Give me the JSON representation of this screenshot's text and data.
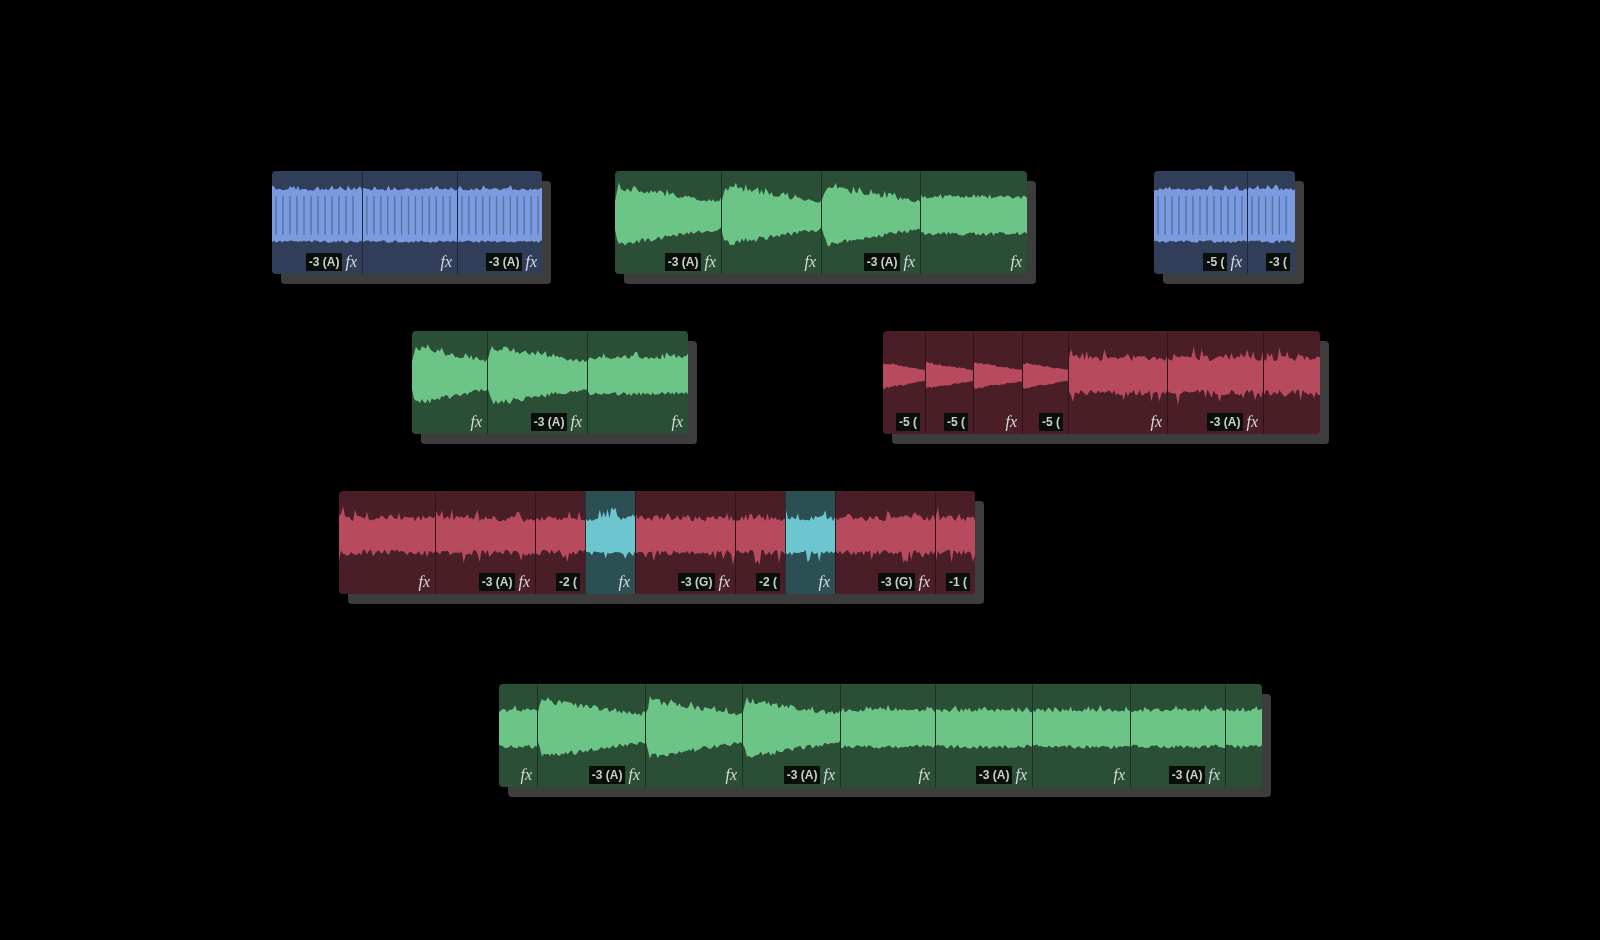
{
  "lanes": [
    {
      "clips": [
        {
          "color": "#7b9be0",
          "segments": [
            {
              "kind": "comb",
              "gain": "-3 (A)",
              "fx": "fx"
            },
            {
              "kind": "comb",
              "fx": "fx"
            },
            {
              "kind": "comb",
              "gain": "-3 (A)",
              "fx": "fx"
            }
          ]
        },
        {
          "color": "#6cc486",
          "segments": [
            {
              "kind": "decay",
              "gain": "-3 (A)",
              "fx": "fx"
            },
            {
              "kind": "decay",
              "fx": "fx"
            },
            {
              "kind": "decay",
              "gain": "-3 (A)",
              "fx": "fx"
            },
            {
              "kind": "sustain",
              "fx": "fx"
            }
          ]
        },
        {
          "color": "#7b9be0",
          "segments": [
            {
              "kind": "comb",
              "gain": "-5 (",
              "fx": "fx"
            },
            {
              "kind": "comb",
              "gain": "-3 ("
            }
          ]
        }
      ]
    },
    {
      "clips": [
        {
          "color": "#6cc486",
          "segments": [
            {
              "kind": "decay",
              "fx": "fx"
            },
            {
              "kind": "decay",
              "gain": "-3 (A)",
              "fx": "fx"
            },
            {
              "kind": "sustain",
              "fx": "fx"
            }
          ]
        },
        {
          "color": "#b84a5e",
          "segments": [
            {
              "kind": "thin",
              "gain": "-5 ("
            },
            {
              "kind": "thin",
              "gain": "-5 ("
            },
            {
              "kind": "thin",
              "fx": "fx"
            },
            {
              "kind": "thin",
              "gain": "-5 ("
            },
            {
              "kind": "noisy",
              "fx": "fx"
            },
            {
              "kind": "noisy",
              "gain": "-3 (A)",
              "fx": "fx"
            },
            {
              "kind": "noisy"
            }
          ]
        }
      ]
    },
    {
      "clips": [
        {
          "color": "#b84a5e",
          "segments": [
            {
              "kind": "noisy",
              "fx": "fx"
            },
            {
              "kind": "noisy",
              "gain": "-3 (A)",
              "fx": "fx"
            },
            {
              "kind": "noisy",
              "gain": "-2 ("
            },
            {
              "kind": "noisy",
              "color": "#6cc5cf",
              "fx": "fx"
            },
            {
              "kind": "noisy",
              "gain": "-3 (G)",
              "fx": "fx"
            },
            {
              "kind": "noisy",
              "gain": "-2 ("
            },
            {
              "kind": "noisy",
              "color": "#6cc5cf",
              "fx": "fx"
            },
            {
              "kind": "noisy",
              "gain": "-3 (G)",
              "fx": "fx"
            },
            {
              "kind": "noisy",
              "gain": "-1 ("
            }
          ]
        }
      ]
    },
    {
      "clips": [
        {
          "color": "#6cc486",
          "segments": [
            {
              "kind": "sustain",
              "fx": "fx"
            },
            {
              "kind": "decay",
              "gain": "-3 (A)",
              "fx": "fx"
            },
            {
              "kind": "decay",
              "fx": "fx"
            },
            {
              "kind": "decay",
              "gain": "-3 (A)",
              "fx": "fx"
            },
            {
              "kind": "sustain",
              "fx": "fx"
            },
            {
              "kind": "sustain",
              "gain": "-3 (A)",
              "fx": "fx"
            },
            {
              "kind": "sustain",
              "fx": "fx"
            },
            {
              "kind": "sustain",
              "gain": "-3 (A)",
              "fx": "fx"
            },
            {
              "kind": "sustain"
            }
          ]
        }
      ]
    }
  ]
}
